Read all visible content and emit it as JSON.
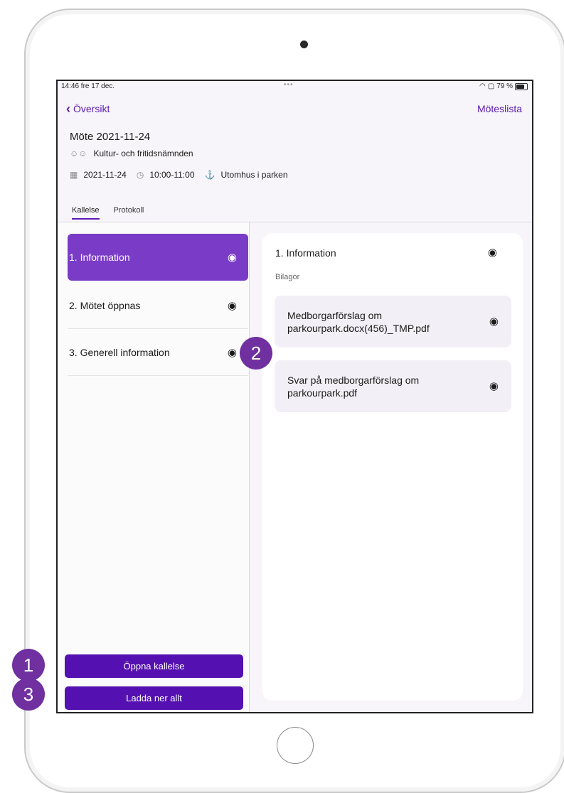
{
  "status": {
    "time": "14:46  fre 17 dec.",
    "dots": "•••",
    "battery": "79 %"
  },
  "nav": {
    "back_label": "Översikt",
    "right_label": "Möteslista"
  },
  "meeting": {
    "title": "Möte 2021-11-24",
    "committee": "Kultur- och fritidsnämnden",
    "date": "2021-11-24",
    "time": "10:00-11:00",
    "location": "Utomhus i parken"
  },
  "tabs": [
    {
      "label": "Kallelse",
      "active": true
    },
    {
      "label": "Protokoll",
      "active": false
    }
  ],
  "agenda": [
    {
      "label": "1. Information",
      "active": true
    },
    {
      "label": "2. Mötet öppnas",
      "active": false
    },
    {
      "label": "3. Generell information",
      "active": false
    }
  ],
  "buttons": {
    "open": "Öppna kallelse",
    "download": "Ladda ner allt"
  },
  "detail": {
    "title": "1. Information",
    "section": "Bilagor",
    "attachments": [
      {
        "name": "Medborgarförslag om parkourpark.docx(456)_TMP.pdf"
      },
      {
        "name": "Svar på medborgarförslag om parkourpark.pdf"
      }
    ]
  },
  "callouts": [
    "1",
    "2",
    "3"
  ],
  "colors": {
    "accent": "#5410b0",
    "active_item": "#7a3bc6",
    "callout": "#7030a0"
  }
}
